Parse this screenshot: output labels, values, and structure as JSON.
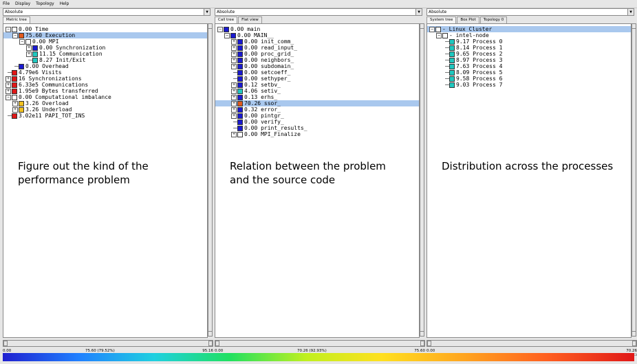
{
  "menu": [
    "File",
    "Display",
    "Topology",
    "Help"
  ],
  "panes": [
    {
      "mode": "Absolute",
      "tabs": [
        "Metric tree"
      ],
      "note": [
        "Figure out the kind of the",
        "performance problem"
      ],
      "scale": {
        "left": "0.00",
        "mid": "75.60 (79.52%)",
        "right": "95.16",
        "fraction": 0.7952
      },
      "rows": [
        {
          "text": "0.00 Time",
          "level": 0,
          "exp": "−",
          "color": "#ffffff"
        },
        {
          "text": "75.60 Execution",
          "level": 1,
          "exp": "−",
          "color": "#e05a1e",
          "sel": true
        },
        {
          "text": "0.00 MPI",
          "level": 2,
          "exp": "−",
          "color": "#ffffff"
        },
        {
          "text": "0.00 Synchronization",
          "level": 3,
          "exp": "+",
          "color": "#1a1ad0"
        },
        {
          "text": "11.15 Communication",
          "level": 3,
          "exp": "+",
          "color": "#20c8c0"
        },
        {
          "text": "8.27 Init/Exit",
          "level": 3,
          "exp": "",
          "color": "#20c8c0"
        },
        {
          "text": "0.00 Overhead",
          "level": 1,
          "exp": "",
          "color": "#1a1ad0"
        },
        {
          "text": "4.79e6 Visits",
          "level": 0,
          "exp": "",
          "color": "#e01818"
        },
        {
          "text": "16 Synchronizations",
          "level": 0,
          "exp": "+",
          "color": "#e01818"
        },
        {
          "text": "6.33e5 Communications",
          "level": 0,
          "exp": "+",
          "color": "#e01818"
        },
        {
          "text": "1.95e9 Bytes transferred",
          "level": 0,
          "exp": "+",
          "color": "#e01818"
        },
        {
          "text": "0.00 Computational imbalance",
          "level": 0,
          "exp": "−",
          "color": "#ffffff"
        },
        {
          "text": "3.26 Overload",
          "level": 1,
          "exp": "+",
          "color": "#f0c020"
        },
        {
          "text": "3.26 Underload",
          "level": 1,
          "exp": "+",
          "color": "#f0c020"
        },
        {
          "text": "3.02e11 PAPI_TOT_INS",
          "level": 0,
          "exp": "",
          "color": "#e01818"
        }
      ]
    },
    {
      "mode": "Absolute",
      "tabs": [
        "Call tree",
        "Flat view"
      ],
      "note": [
        "Relation between the problem",
        "and the source code"
      ],
      "scale": {
        "left": "0.00",
        "mid": "70.26 (92.93%)",
        "right": "75.60",
        "fraction": 0.9293
      },
      "rows": [
        {
          "text": "0.00 main",
          "level": 0,
          "exp": "−",
          "color": "#1a1ad0"
        },
        {
          "text": "0.00 MAIN__",
          "level": 1,
          "exp": "−",
          "color": "#1a1ad0"
        },
        {
          "text": "0.00 init_comm_",
          "level": 2,
          "exp": "+",
          "color": "#1a1ad0"
        },
        {
          "text": "0.00 read_input_",
          "level": 2,
          "exp": "+",
          "color": "#1a1ad0"
        },
        {
          "text": "0.00 proc_grid_",
          "level": 2,
          "exp": "+",
          "color": "#1a1ad0"
        },
        {
          "text": "0.00 neighbors_",
          "level": 2,
          "exp": "+",
          "color": "#1a1ad0"
        },
        {
          "text": "0.00 subdomain_",
          "level": 2,
          "exp": "+",
          "color": "#1a1ad0"
        },
        {
          "text": "0.00 setcoeff_",
          "level": 2,
          "exp": "",
          "color": "#1a1ad0"
        },
        {
          "text": "0.00 sethyper_",
          "level": 2,
          "exp": "",
          "color": "#1a1ad0"
        },
        {
          "text": "0.12 setbv_",
          "level": 2,
          "exp": "+",
          "color": "#1a1ad0"
        },
        {
          "text": "4.06 setiv_",
          "level": 2,
          "exp": "+",
          "color": "#20c8c0"
        },
        {
          "text": "0.13 erhs_",
          "level": 2,
          "exp": "+",
          "color": "#1a1ad0"
        },
        {
          "text": "70.26 ssor_",
          "level": 2,
          "exp": "+",
          "color": "#e05a1e",
          "sel": true
        },
        {
          "text": "0.32 error_",
          "level": 2,
          "exp": "+",
          "color": "#1a1ad0"
        },
        {
          "text": "0.00 pintgr_",
          "level": 2,
          "exp": "+",
          "color": "#1a1ad0"
        },
        {
          "text": "0.00 verify_",
          "level": 2,
          "exp": "",
          "color": "#1a1ad0"
        },
        {
          "text": "0.00 print_results_",
          "level": 2,
          "exp": "",
          "color": "#1a1ad0"
        },
        {
          "text": "0.00 MPI_Finalize",
          "level": 2,
          "exp": "+",
          "color": "#ffffff"
        }
      ]
    },
    {
      "mode": "Absolute",
      "tabs": [
        "System tree",
        "Box Plot",
        "Topology 0"
      ],
      "note": [
        "Distribution across the processes"
      ],
      "scale": {
        "left": "0.00",
        "mid": "",
        "right": "70.26",
        "fraction": 0
      },
      "rows": [
        {
          "text": "- Linux Cluster",
          "level": 0,
          "exp": "−",
          "color": "#ffffff",
          "sel": true
        },
        {
          "text": "- intel-node",
          "level": 1,
          "exp": "−",
          "color": "#ffffff"
        },
        {
          "text": "9.17 Process 0",
          "level": 2,
          "exp": "",
          "color": "#20c8c0"
        },
        {
          "text": "8.14 Process 1",
          "level": 2,
          "exp": "",
          "color": "#20c8c0"
        },
        {
          "text": "9.65 Process 2",
          "level": 2,
          "exp": "",
          "color": "#20c8c0"
        },
        {
          "text": "8.97 Process 3",
          "level": 2,
          "exp": "",
          "color": "#20c8c0"
        },
        {
          "text": "7.63 Process 4",
          "level": 2,
          "exp": "",
          "color": "#20c8c0"
        },
        {
          "text": "8.09 Process 5",
          "level": 2,
          "exp": "",
          "color": "#20c8c0"
        },
        {
          "text": "9.58 Process 6",
          "level": 2,
          "exp": "",
          "color": "#20c8c0"
        },
        {
          "text": "9.03 Process 7",
          "level": 2,
          "exp": "",
          "color": "#20c8c0"
        }
      ]
    }
  ]
}
